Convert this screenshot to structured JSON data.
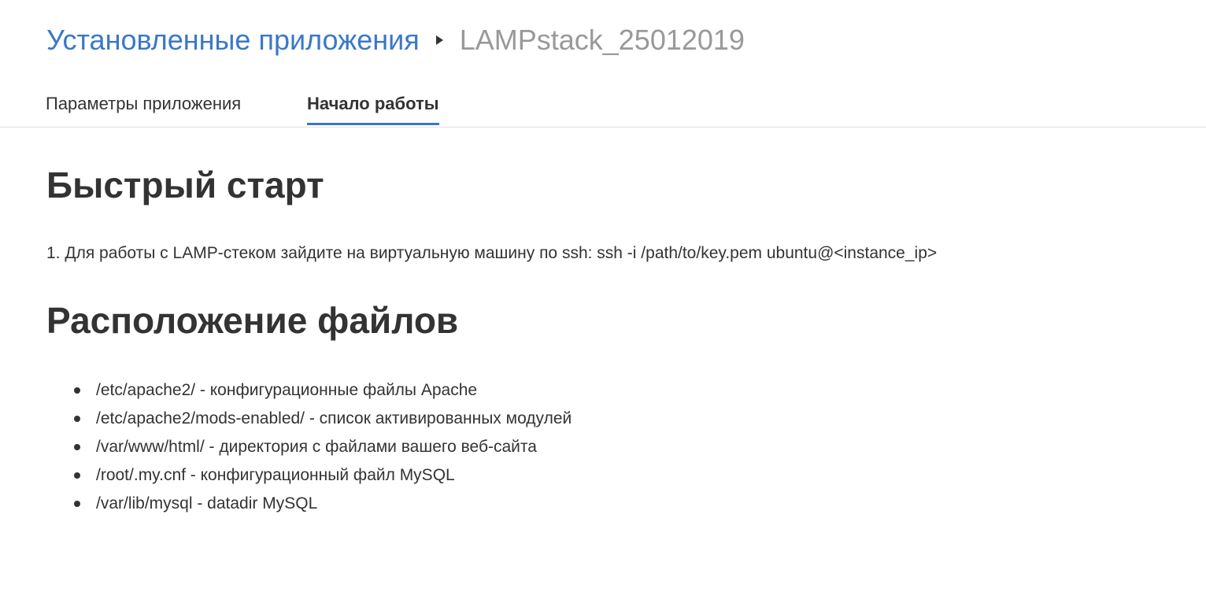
{
  "breadcrumb": {
    "parent_label": "Установленные приложения",
    "separator_icon": "triangle-right-icon",
    "current_label": "LAMPstack_25012019"
  },
  "tabs": [
    {
      "label": "Параметры приложения",
      "active": false
    },
    {
      "label": "Начало работы",
      "active": true
    }
  ],
  "colors": {
    "accent": "#3a78c8",
    "text": "#333333",
    "muted": "#999999",
    "divider": "#e2e2e2"
  },
  "content": {
    "quick_start_heading": "Быстрый старт",
    "step_1": "1. Для работы с LAMP-стеком зайдите на виртуальную машину по ssh: ssh -i /path/to/key.pem ubuntu@<instance_ip>",
    "files_heading": "Расположение файлов",
    "files": [
      "/etc/apache2/ - конфигурационные файлы Apache",
      "/etc/apache2/mods-enabled/ - список активированных модулей",
      "/var/www/html/ - директория с файлами вашего веб-сайта",
      "/root/.my.cnf - конфигурационный файл MySQL",
      "/var/lib/mysql - datadir MySQL"
    ]
  }
}
